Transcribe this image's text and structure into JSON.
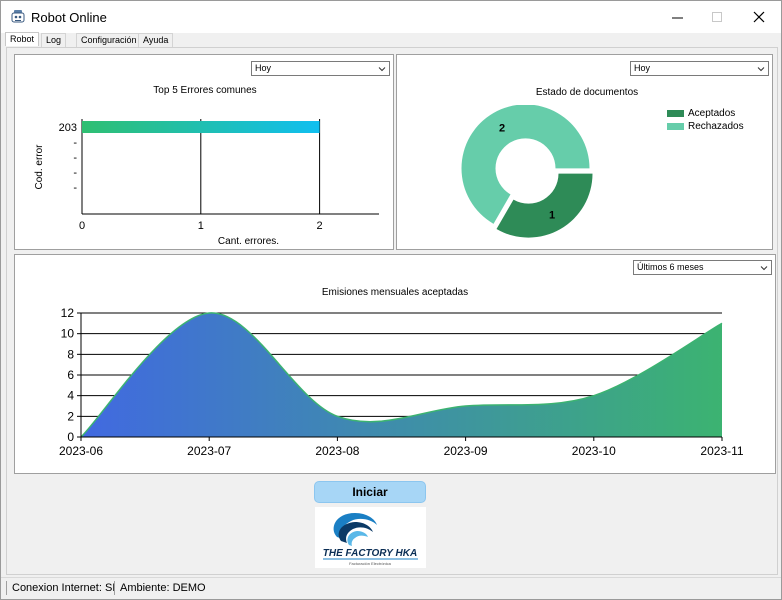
{
  "window": {
    "title": "Robot Online"
  },
  "tabs": [
    {
      "label": "Robot",
      "active": true
    },
    {
      "label": "Log",
      "active": false
    },
    {
      "label": "Configuración",
      "active": false
    },
    {
      "label": "Ayuda",
      "active": false
    }
  ],
  "errors_panel": {
    "range_selected": "Hoy"
  },
  "docs_panel": {
    "range_selected": "Hoy"
  },
  "monthly_panel": {
    "range_selected": "Últimos 6 meses"
  },
  "chart_data": [
    {
      "type": "bar",
      "orientation": "horizontal",
      "title": "Top 5 Errores comunes",
      "xlabel": "Cant. errores.",
      "ylabel": "Cod. error",
      "categories": [
        "203",
        "-",
        "-",
        "-",
        "-"
      ],
      "values": [
        2,
        0,
        0,
        0,
        0
      ],
      "xlim": [
        0,
        2.5
      ],
      "xticks": [
        "0",
        "1",
        "2"
      ],
      "grid": true,
      "bar_color_start": "#2fbf71",
      "bar_color_end": "#10bff0"
    },
    {
      "type": "pie",
      "donut": true,
      "title": "Estado de documentos",
      "labels": [
        "Aceptados",
        "Rechazados"
      ],
      "values": [
        1,
        2
      ],
      "colors": [
        "#2e8b57",
        "#66cdaa"
      ],
      "legend": "top-right"
    },
    {
      "type": "area",
      "title": "Emisiones mensuales aceptadas",
      "categories": [
        "2023-06",
        "2023-07",
        "2023-08",
        "2023-09",
        "2023-10",
        "2023-11"
      ],
      "values": [
        0,
        12,
        2,
        3,
        4,
        11
      ],
      "ylim": [
        0,
        12
      ],
      "yticks": [
        "0",
        "2",
        "4",
        "6",
        "8",
        "10",
        "12"
      ],
      "grid": true,
      "fill_color_start": "#4169e1",
      "fill_color_end": "#3cb371"
    }
  ],
  "actions": {
    "start_label": "Iniciar"
  },
  "logo": {
    "text": "THE FACTORY HKA",
    "subtext": "Facturación Electrónica"
  },
  "status": {
    "internet": "Conexion Internet: SI",
    "environment": "Ambiente: DEMO"
  }
}
